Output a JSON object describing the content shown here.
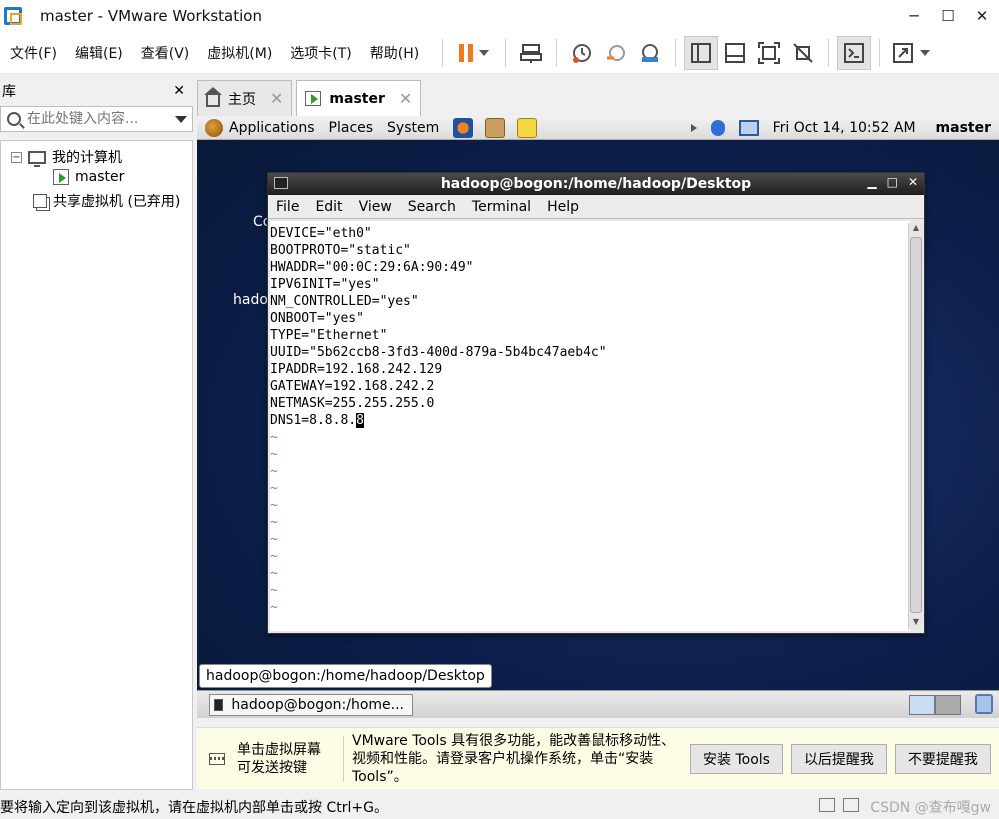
{
  "window": {
    "title": "master - VMware Workstation",
    "controls": [
      "─",
      "☐",
      "✕"
    ]
  },
  "menu": [
    "文件(F)",
    "编辑(E)",
    "查看(V)",
    "虚拟机(M)",
    "选项卡(T)",
    "帮助(H)"
  ],
  "library": {
    "header": "库",
    "close": "✕",
    "search_placeholder": "在此处键入内容...",
    "tree": {
      "my_computer": "我的计算机",
      "vm": "master",
      "shared": "共享虚拟机 (已弃用)",
      "toggle": "−"
    }
  },
  "tabs": [
    {
      "label": "主页",
      "close": "✕"
    },
    {
      "label": "master",
      "close": "✕"
    }
  ],
  "guest": {
    "panel": {
      "menus": [
        "Applications",
        "Places",
        "System"
      ],
      "clock": "Fri Oct 14, 10:52 AM",
      "user": "master"
    },
    "desktop_labels": [
      "Co",
      "hado"
    ],
    "terminal": {
      "title": "hadoop@bogon:/home/hadoop/Desktop",
      "menus": [
        "File",
        "Edit",
        "View",
        "Search",
        "Terminal",
        "Help"
      ],
      "lines": [
        "DEVICE=\"eth0\"",
        "BOOTPROTO=\"static\"",
        "HWADDR=\"00:0C:29:6A:90:49\"",
        "IPV6INIT=\"yes\"",
        "NM_CONTROLLED=\"yes\"",
        "ONBOOT=\"yes\"",
        "TYPE=\"Ethernet\"",
        "UUID=\"5b62ccb8-3fd3-400d-879a-5b4bc47aeb4c\"",
        "IPADDR=192.168.242.129",
        "GATEWAY=192.168.242.2",
        "NETMASK=255.255.255.0"
      ],
      "last_line_prefix": "DNS1=8.8.8.",
      "cursor_char": "8",
      "tilde": "~",
      "tilde_count": 11
    },
    "tooltip": "hadoop@bogon:/home/hadoop/Desktop",
    "taskbar_item": "hadoop@bogon:/home..."
  },
  "tools_bar": {
    "hint": "单击虚拟屏幕\n可发送按键",
    "message": "VMware Tools 具有很多功能，能改善鼠标移动性、视频和性能。请登录客户机操作系统，单击“安装 Tools”。",
    "buttons": [
      "安装 Tools",
      "以后提醒我",
      "不要提醒我"
    ]
  },
  "status": {
    "text": "要将输入定向到该虚拟机，请在虚拟机内部单击或按 Ctrl+G。",
    "watermark": "CSDN @查布嘎gw"
  }
}
